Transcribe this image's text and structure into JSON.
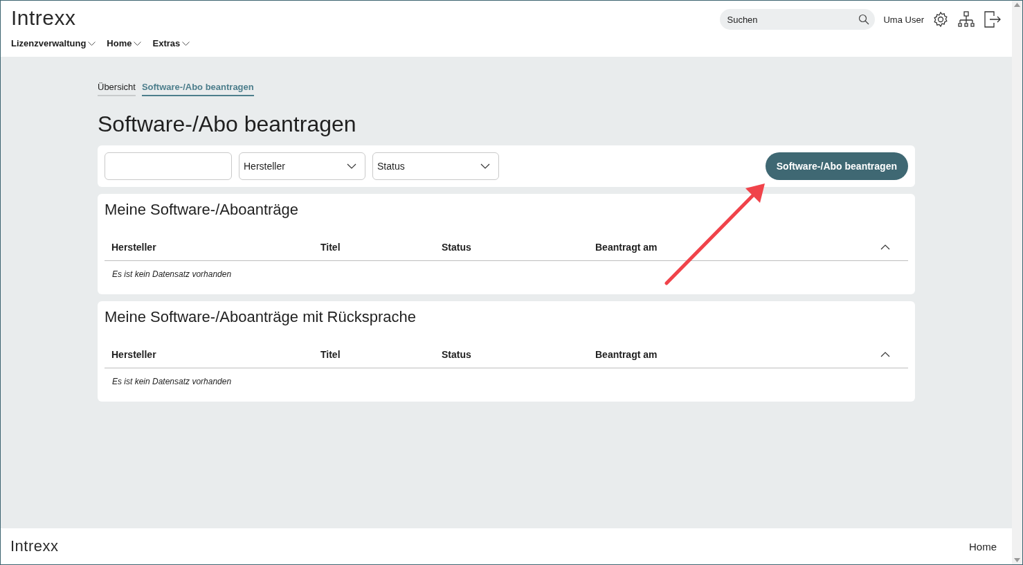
{
  "header": {
    "logo": "Intrexx",
    "menu": [
      {
        "label": "Lizenzverwaltung"
      },
      {
        "label": "Home"
      },
      {
        "label": "Extras"
      }
    ],
    "search": {
      "placeholder": "Suchen"
    },
    "user": "Uma User"
  },
  "breadcrumbs": [
    {
      "label": "Übersicht",
      "selected": false
    },
    {
      "label": "Software-/Abo beantragen",
      "selected": true
    }
  ],
  "page_title": "Software-/Abo beantragen",
  "filters": {
    "selects": [
      {
        "value": "Hersteller"
      },
      {
        "value": "Status"
      }
    ],
    "action_button": "Software-/Abo beantragen"
  },
  "sections": [
    {
      "title": "Meine Software-/Aboanträge",
      "columns": [
        "Hersteller",
        "Titel",
        "Status",
        "Beantragt am"
      ],
      "empty_text": "Es ist kein Datensatz vorhanden"
    },
    {
      "title": "Meine Software-/Aboanträge mit Rücksprache",
      "columns": [
        "Hersteller",
        "Titel",
        "Status",
        "Beantragt am"
      ],
      "empty_text": "Es ist kein Datensatz vorhanden"
    }
  ],
  "footer": {
    "logo": "Intrexx",
    "link": "Home"
  }
}
